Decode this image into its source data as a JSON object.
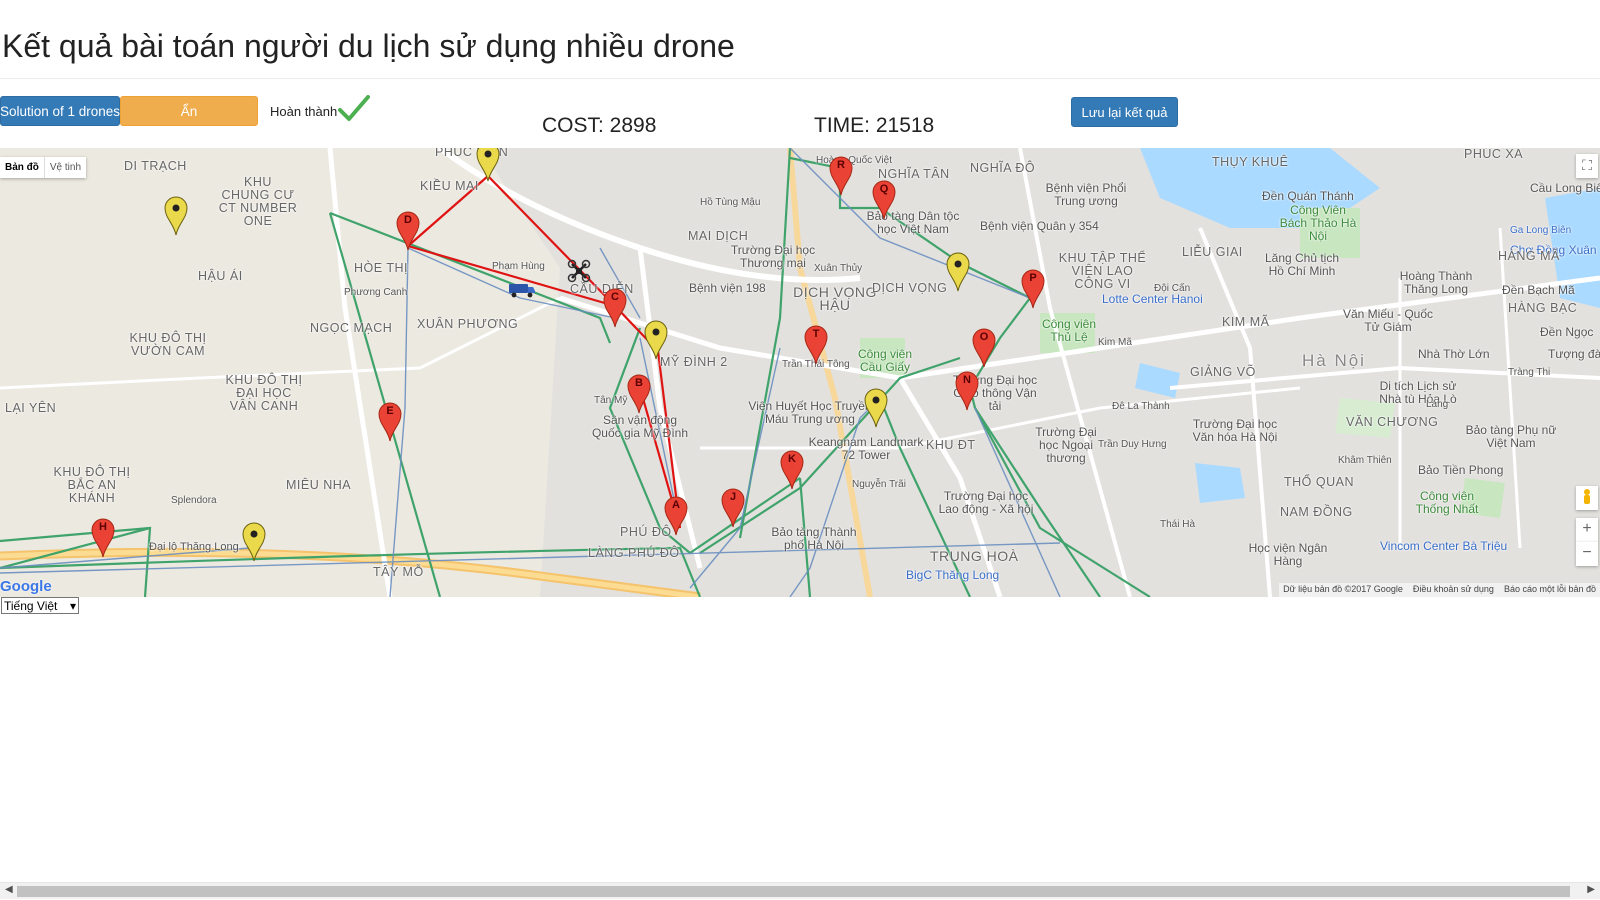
{
  "header": {
    "title": "Kết quả bài toán người du lịch sử dụng nhiều drone"
  },
  "toolbar": {
    "solution_label": "Solution of 1 drones",
    "hide_label": "Ẩn",
    "status_label": "Hoàn thành",
    "save_label": "Lưu lại kết quả"
  },
  "metrics": {
    "cost": "COST: 2898",
    "time": "TIME: 21518"
  },
  "map": {
    "map_type": {
      "map": "Bản đồ",
      "satellite": "Vệ tinh"
    },
    "zoom_in": "+",
    "zoom_out": "−",
    "fullscreen": "⛶",
    "logo": "Google",
    "attribution": {
      "data": "Dữ liệu bản đồ ©2017 Google",
      "terms": "Điều khoản sử dụng",
      "report": "Báo cáo một lỗi bản đồ"
    },
    "places": [
      "PHÚC DIỄN",
      "DI TRẠCH",
      "KHU CHUNG CƯ CT NUMBER ONE",
      "KIỀU MAI",
      "MAI DỊCH",
      "HẬU ÁI",
      "HÒE THỊ",
      "NGỌC MẠCH",
      "XUÂN PHƯƠNG",
      "KHU ĐÔ THỊ VƯỜN CAM",
      "KHU ĐÔ THỊ ĐẠI HỌC VÂN CANH",
      "LẠI YÊN",
      "KHU ĐÔ THỊ BẮC AN KHÁNH",
      "MIÊU NHA",
      "Splendora",
      "Đại lộ Thăng Long",
      "TÂY MỖ",
      "LÀNG PHÚ ĐÔ",
      "PHÚ ĐÔ",
      "MỸ ĐÌNH 2",
      "CẦU DIỄN",
      "Sân vận động Quốc gia Mỹ Đình",
      "Trường Đại học Thương mại",
      "Bệnh viện 198",
      "DỊCH VỌNG HẬU",
      "Công viên Cầu Giấy",
      "Viện Huyết Học Truyền Máu Trung ương",
      "Keangnam Landmark 72 Tower",
      "Bảo tàng Thành phố Hà Nội",
      "NGHĨA TÂN",
      "NGHĨA ĐÔ",
      "Bảo tàng Dân tộc học Việt Nam",
      "Bệnh viện Quân y 354",
      "Bệnh viện Phổi Trung ương",
      "DỊCH VỌNG",
      "KHU TẬP THỂ VIỆN LAO CÔNG VI",
      "Lotte Center Hanoi",
      "Công viên Thủ Lệ",
      "Trường Đại học Giao thông Vận tải",
      "KHU ĐT",
      "Trường Đại học Ngoại thương",
      "Trường Đại học Lao động - Xã hội",
      "TRUNG HOÀ",
      "BigC Thăng Long",
      "THỤY KHUÊ",
      "Đền Quán Thánh",
      "Công Viên Bách Thảo Hà Nội",
      "LIỄU GIAI",
      "Lăng Chủ tịch Hồ Chí Minh",
      "KIM MÃ",
      "GIẢNG VÕ",
      "Hà Nội",
      "VĂN CHƯƠNG",
      "Trường Đại học Văn hóa Hà Nội",
      "THỔ QUAN",
      "NAM ĐỒNG",
      "Vincom Center Bà Triệu",
      "Học viện Ngân Hàng",
      "Bảo Tiền Phong",
      "Công viên Thống Nhất",
      "Bảo tàng Phụ nữ Việt Nam",
      "Di tích Lịch sử Nhà tù Hỏa Lò",
      "Nhà Thờ Lớn",
      "Hoàng Thành Thăng Long",
      "Văn Miếu - Quốc Tử Giám",
      "PHÚC XÁ",
      "Cầu Long Biên",
      "Chợ Đồng Xuân",
      "HÀNG MÃ",
      "Đền Bạch Mã",
      "HÀNG BẠC",
      "Đền Ngọc",
      "Tượng đài",
      "Ga Long Biên",
      "Tràng Thi",
      "Khâm Thiên",
      "Phương Canh",
      "Phạm Hùng",
      "Tân Mỹ",
      "Hồ Tùng Mậu",
      "Xuân Thủy",
      "Trần Thái Tông",
      "Hoàng Quốc Việt",
      "Đội Cấn",
      "Kim Mã",
      "Đê La Thành",
      "Trần Duy Hưng",
      "Nguyễn Trãi",
      "Láng",
      "Thái Hà"
    ],
    "pins": [
      "A",
      "B",
      "C",
      "D",
      "E",
      "H",
      "J",
      "K",
      "N",
      "O",
      "P",
      "Q",
      "R",
      "T"
    ]
  },
  "language": {
    "selected": "Tiếng Việt"
  }
}
